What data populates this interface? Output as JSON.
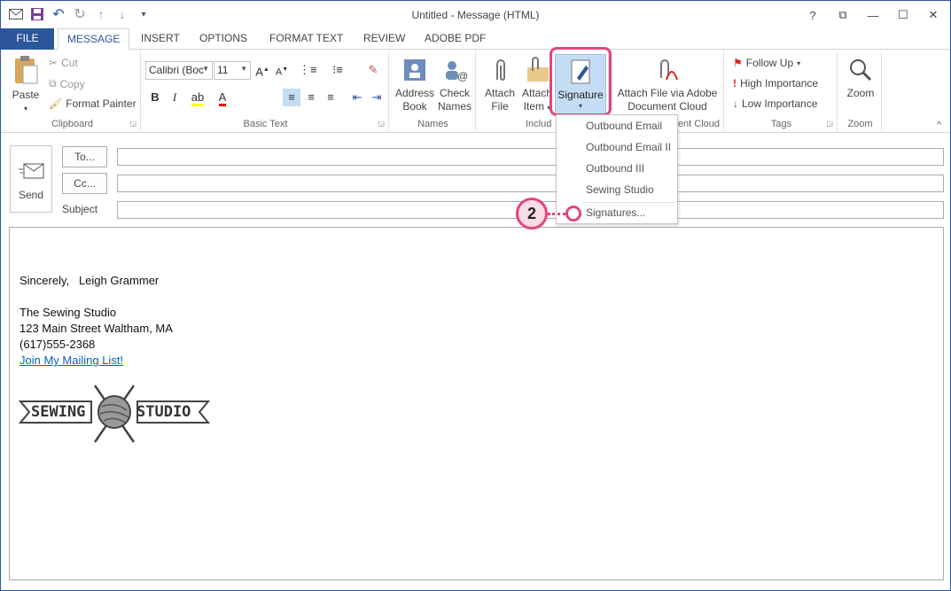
{
  "window": {
    "title": "Untitled - Message (HTML)",
    "controls": [
      "?",
      "⧉",
      "—",
      "☐",
      "✕"
    ]
  },
  "qat": {
    "icons": [
      "envelope-icon",
      "save-icon",
      "undo-icon",
      "redo-icon",
      "up-arrow-icon",
      "down-arrow-icon",
      "customize-icon"
    ]
  },
  "tabs": [
    "FILE",
    "MESSAGE",
    "INSERT",
    "OPTIONS",
    "FORMAT TEXT",
    "REVIEW",
    "ADOBE PDF"
  ],
  "ribbon": {
    "clipboard": {
      "label": "Clipboard",
      "paste": "Paste",
      "cut": "Cut",
      "copy": "Copy",
      "format_painter": "Format Painter"
    },
    "basic_text": {
      "label": "Basic Text",
      "font": "Calibri (Boc",
      "size": "11"
    },
    "names": {
      "label": "Names",
      "address_book_1": "Address",
      "address_book_2": "Book",
      "check_names_1": "Check",
      "check_names_2": "Names"
    },
    "include": {
      "label": "Includ",
      "attach_file_1": "Attach",
      "attach_file_2": "File",
      "attach_item_1": "Attach",
      "attach_item_2": "Item",
      "signature": "Signature"
    },
    "adobe": {
      "label": "ent Cloud",
      "attach_1": "Attach File via Adobe",
      "attach_2": "Document Cloud"
    },
    "tags": {
      "label": "Tags",
      "follow_up": "Follow Up",
      "high": "High Importance",
      "low": "Low Importance"
    },
    "zoom": {
      "label": "Zoom",
      "zoom": "Zoom"
    }
  },
  "form": {
    "send": "Send",
    "to": "To...",
    "cc": "Cc...",
    "subject": "Subject"
  },
  "signature_menu": {
    "items": [
      "Outbound Email",
      "Outbound Email II",
      "Outbound III",
      "Sewing Studio"
    ],
    "signatures": "Signatures..."
  },
  "callout": "2",
  "body": {
    "line1": "Sincerely,   Leigh Grammer",
    "line2": "The Sewing Studio",
    "line3": "123 Main Street Waltham, MA",
    "line4": "(617)555-2368",
    "link": "Join My Mailing List!",
    "logo_left": "SEWING",
    "logo_right": "STUDIO"
  },
  "colors": {
    "accent": "#2b579a",
    "highlight": "#e2457e",
    "link": "#0563c1"
  }
}
